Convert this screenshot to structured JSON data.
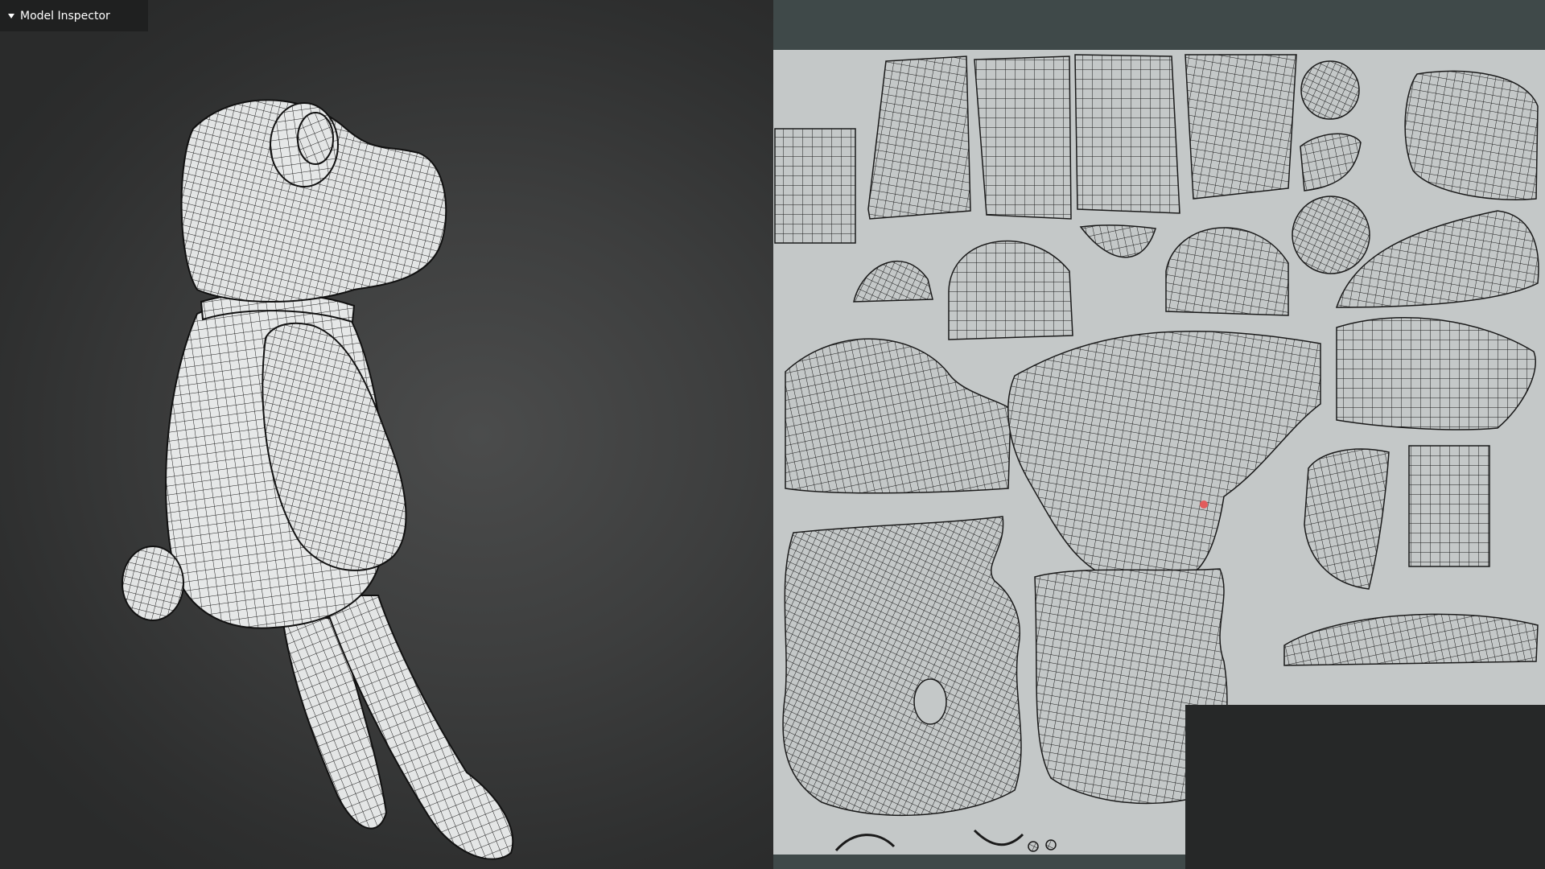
{
  "inspector": {
    "title": "Model Inspector",
    "toggle_icon": "caret-down-icon"
  },
  "viewport": {
    "mesh_color": "#e8eaea",
    "wire_color": "#1b1b1b",
    "background_center": "#4b4c4c",
    "background_edge": "#2a2b2b"
  },
  "uv_editor": {
    "canvas_color": "#c4c8c8",
    "border_color": "#3f4949",
    "island_count": 26
  },
  "overlay": {
    "color": "#262828"
  }
}
